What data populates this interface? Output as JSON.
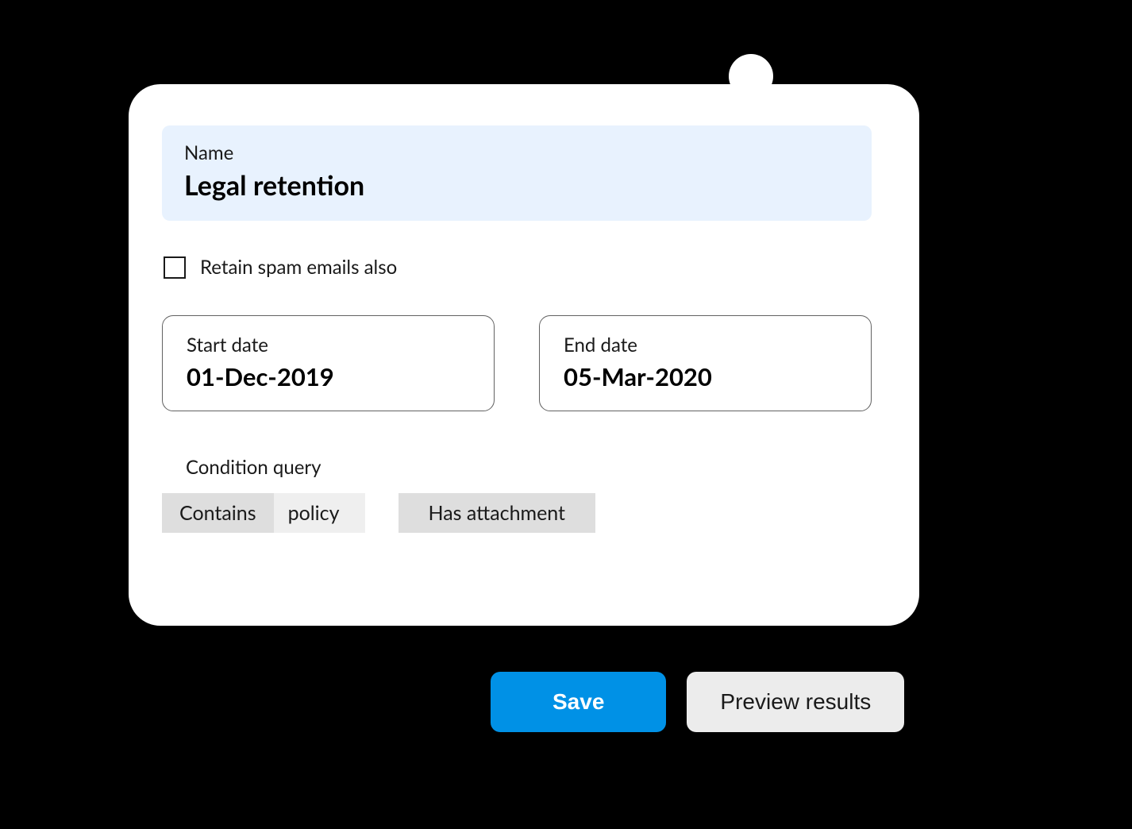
{
  "form": {
    "name_label": "Name",
    "name_value": "Legal retention",
    "retain_spam_label": "Retain spam emails also",
    "retain_spam_checked": false,
    "start_date": {
      "label": "Start date",
      "value": "01-Dec-2019"
    },
    "end_date": {
      "label": "End date",
      "value": "05-Mar-2020"
    },
    "condition": {
      "label": "Condition query",
      "chips": [
        {
          "operator": "Contains",
          "value": "policy"
        },
        {
          "label": "Has attachment"
        }
      ]
    }
  },
  "actions": {
    "save_label": "Save",
    "preview_label": "Preview results"
  }
}
